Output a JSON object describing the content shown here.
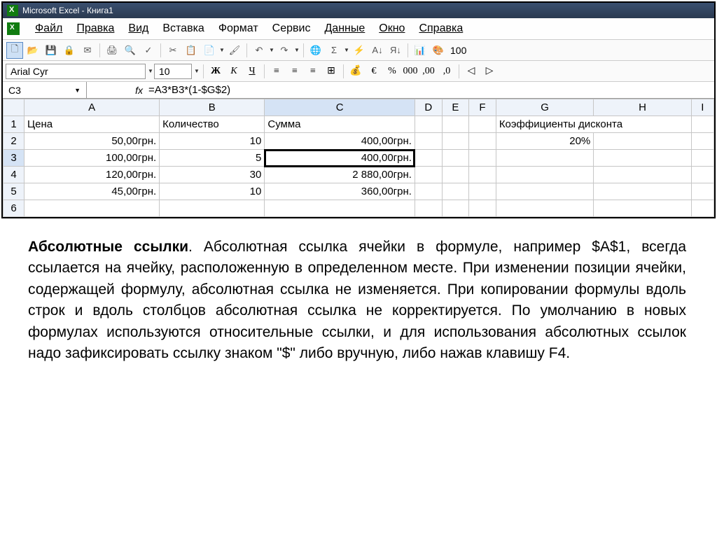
{
  "title": "Microsoft Excel - Книга1",
  "menus": {
    "file": "Файл",
    "edit": "Правка",
    "view": "Вид",
    "insert": "Вставка",
    "format": "Формат",
    "tools": "Сервис",
    "data": "Данные",
    "window": "Окно",
    "help": "Справка"
  },
  "zoom": "100",
  "font": {
    "name": "Arial Cyr",
    "size": "10"
  },
  "cell_ref": "C3",
  "fx_label": "fx",
  "formula": "=A3*B3*(1-$G$2)",
  "columns": [
    "A",
    "B",
    "C",
    "D",
    "E",
    "F",
    "G",
    "H",
    "I"
  ],
  "rows": {
    "1": {
      "A": "Цена",
      "B": "Количество",
      "C": "Сумма",
      "G": "Коэффициенты дисконта"
    },
    "2": {
      "A": "50,00грн.",
      "B": "10",
      "C": "400,00грн.",
      "G": "20%"
    },
    "3": {
      "A": "100,00грн.",
      "B": "5",
      "C": "400,00грн."
    },
    "4": {
      "A": "120,00грн.",
      "B": "30",
      "C": "2 880,00грн."
    },
    "5": {
      "A": "45,00грн.",
      "B": "10",
      "C": "360,00грн."
    }
  },
  "row_labels": [
    "1",
    "2",
    "3",
    "4",
    "5",
    "6"
  ],
  "explain_bold": "Абсолютные ссылки",
  "explain_body": ". Абсолютная ссылка ячейки в формуле, например $A$1, всегда ссылается на ячейку, расположенную в определенном месте. При изменении позиции ячейки, содержащей формулу, абсолютная ссылка не изменяется. При копировании формулы вдоль строк и вдоль столбцов абсолютная ссылка не корректируется. По умолчанию в новых формулах используются относительные ссылки, и для использования абсолютных ссылок надо зафиксировать ссылку знаком \"$\" либо вручную, либо нажав клавишу F4."
}
